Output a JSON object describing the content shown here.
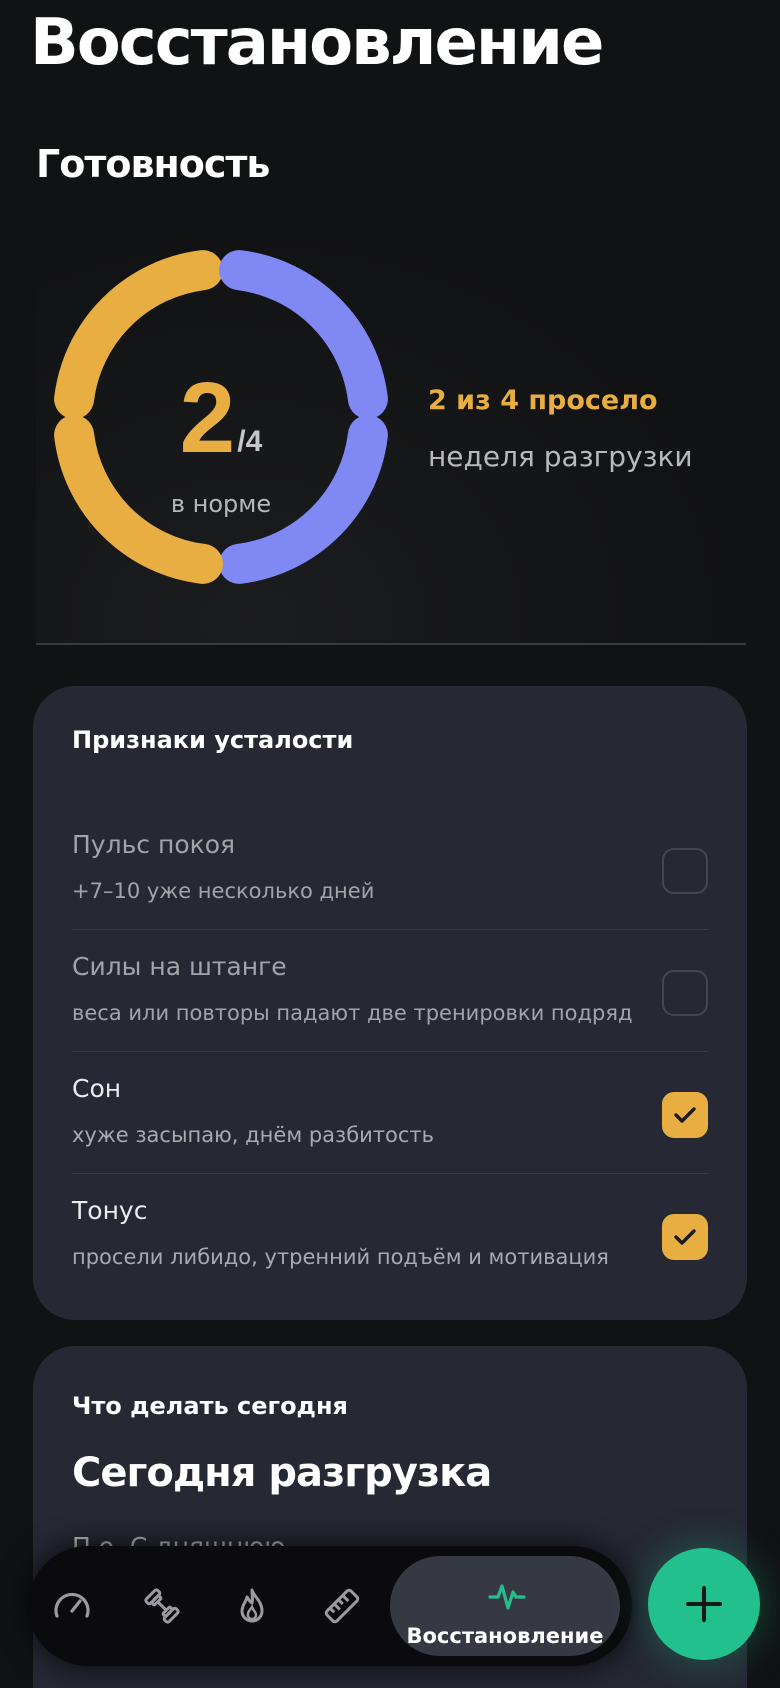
{
  "page_title": "Восстановление",
  "readiness": {
    "title": "Готовность",
    "value": "2",
    "total": "/4",
    "label": "в норме",
    "segments": [
      {
        "name": "top-left",
        "status": "dropped",
        "color": "#E9AE42"
      },
      {
        "name": "top-right",
        "status": "ok",
        "color": "#8088F4"
      },
      {
        "name": "bottom-right",
        "status": "ok",
        "color": "#8088F4"
      },
      {
        "name": "bottom-left",
        "status": "dropped",
        "color": "#E9AE42"
      }
    ],
    "status_text": "2 из 4 просело",
    "status_sub": "неделя разгрузки"
  },
  "fatigue": {
    "title": "Признаки усталости",
    "items": [
      {
        "name": "Пульс покоя",
        "desc": "+7–10 уже несколько дней",
        "checked": false
      },
      {
        "name": "Силы на штанге",
        "desc": "веса или повторы падают две тренировки подряд",
        "checked": false
      },
      {
        "name": "Сон",
        "desc": "хуже засыпаю, днём разбитость",
        "checked": true
      },
      {
        "name": "Тонус",
        "desc": "просели либидо, утренний подъём и мотивация",
        "checked": true
      }
    ]
  },
  "today": {
    "title": "Что делать сегодня",
    "headline": "Сегодня разгрузка",
    "text_partial": "П                                                       о. С  дняшнюю"
  },
  "nav": {
    "items": [
      {
        "icon": "speedometer-icon"
      },
      {
        "icon": "dumbbell-icon"
      },
      {
        "icon": "flame-icon"
      },
      {
        "icon": "ruler-icon"
      }
    ],
    "active_label": "Восстановление",
    "active_icon": "pulse-icon"
  },
  "fab": {
    "icon": "plus-icon"
  },
  "colors": {
    "background": "#111214",
    "card": "#262833",
    "accent_orange": "#E9AE42",
    "accent_blue": "#8088F4",
    "accent_green": "#21C08D"
  }
}
